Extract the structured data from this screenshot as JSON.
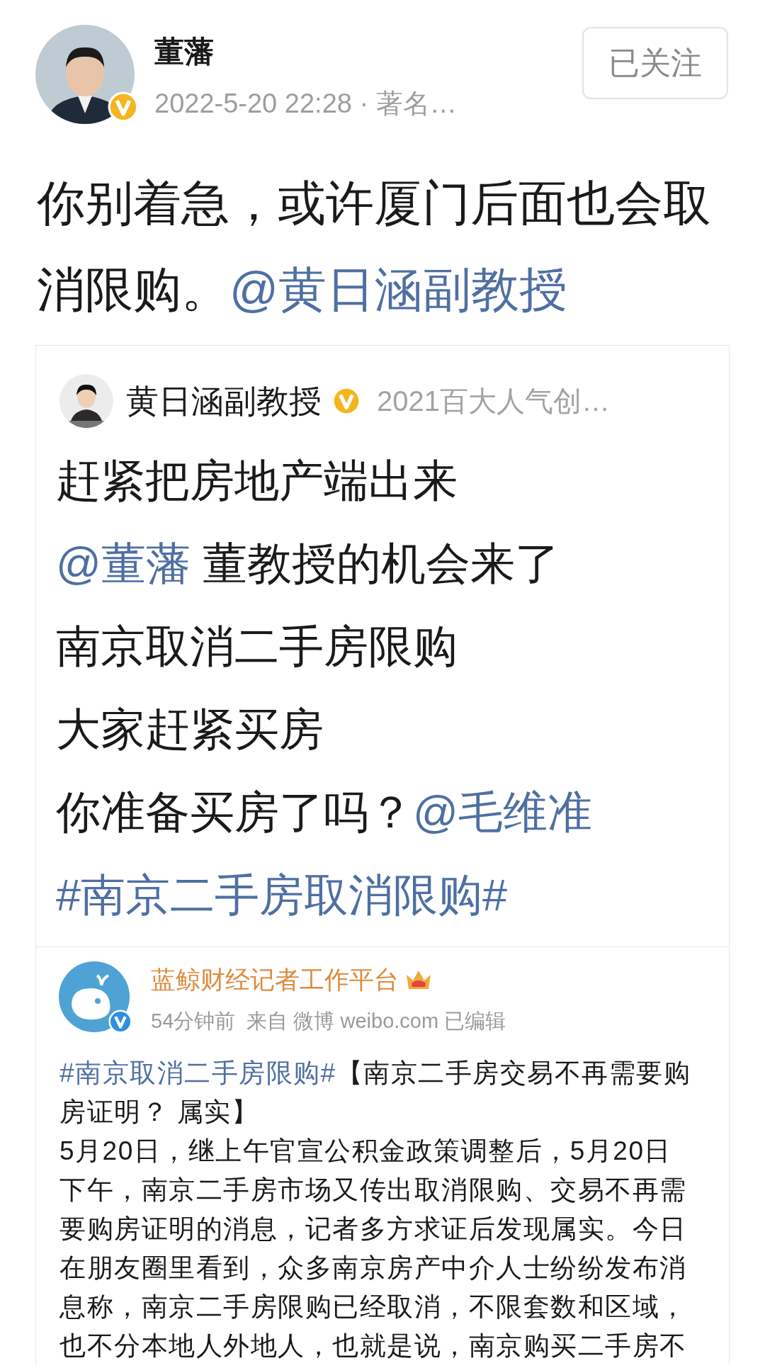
{
  "author": {
    "name": "董藩",
    "verified": true,
    "meta": "2022-5-20 22:28 · 著名…"
  },
  "follow_button": {
    "label": "已关注"
  },
  "post": {
    "segments": [
      {
        "kind": "text",
        "text": "你别着急，或许厦门后面也会取消限购。"
      },
      {
        "kind": "mention",
        "text": "@黄日涵副教授"
      }
    ]
  },
  "quote": {
    "author": {
      "name": "黄日涵副教授",
      "verified": true,
      "meta": "2021百大人气创…"
    },
    "lines": [
      [
        {
          "kind": "text",
          "text": "赶紧把房地产端出来"
        }
      ],
      [
        {
          "kind": "mention",
          "text": "@董藩"
        },
        {
          "kind": "text",
          "text": " 董教授的机会来了"
        }
      ],
      [
        {
          "kind": "text",
          "text": "南京取消二手房限购"
        }
      ],
      [
        {
          "kind": "text",
          "text": "大家赶紧买房"
        }
      ],
      [
        {
          "kind": "text",
          "text": "你准备买房了吗？"
        },
        {
          "kind": "mention",
          "text": "@毛维准"
        }
      ],
      [
        {
          "kind": "hashtag",
          "text": "#南京二手房取消限购#"
        }
      ]
    ]
  },
  "embedded": {
    "author": {
      "name": "蓝鲸财经记者工作平台",
      "verified": true,
      "meta": "54分钟前  来自 微博 weibo.com 已编辑"
    },
    "lines": [
      [
        {
          "kind": "hashtag",
          "text": "#南京取消二手房限购#"
        },
        {
          "kind": "text",
          "text": "【南京二手房交易不再需要购"
        }
      ],
      [
        {
          "kind": "text",
          "text": "房证明？ 属实】"
        }
      ],
      [
        {
          "kind": "text",
          "text": "5月20日，继上午官宣公积金政策调整后，5月20日"
        }
      ],
      [
        {
          "kind": "text",
          "text": "下午，南京二手房市场又传出取消限购、交易不再需"
        }
      ],
      [
        {
          "kind": "text",
          "text": "要购房证明的消息，记者多方求证后发现属实。今日"
        }
      ],
      [
        {
          "kind": "text",
          "text": "在朋友圈里看到，众多南京房产中介人士纷纷发布消"
        }
      ],
      [
        {
          "kind": "text",
          "text": "息称，南京二手房限购已经取消，不限套数和区域，"
        }
      ],
      [
        {
          "kind": "text",
          "text": "也不分本地人外地人，也就是说，南京购买二手房不"
        }
      ]
    ]
  }
}
